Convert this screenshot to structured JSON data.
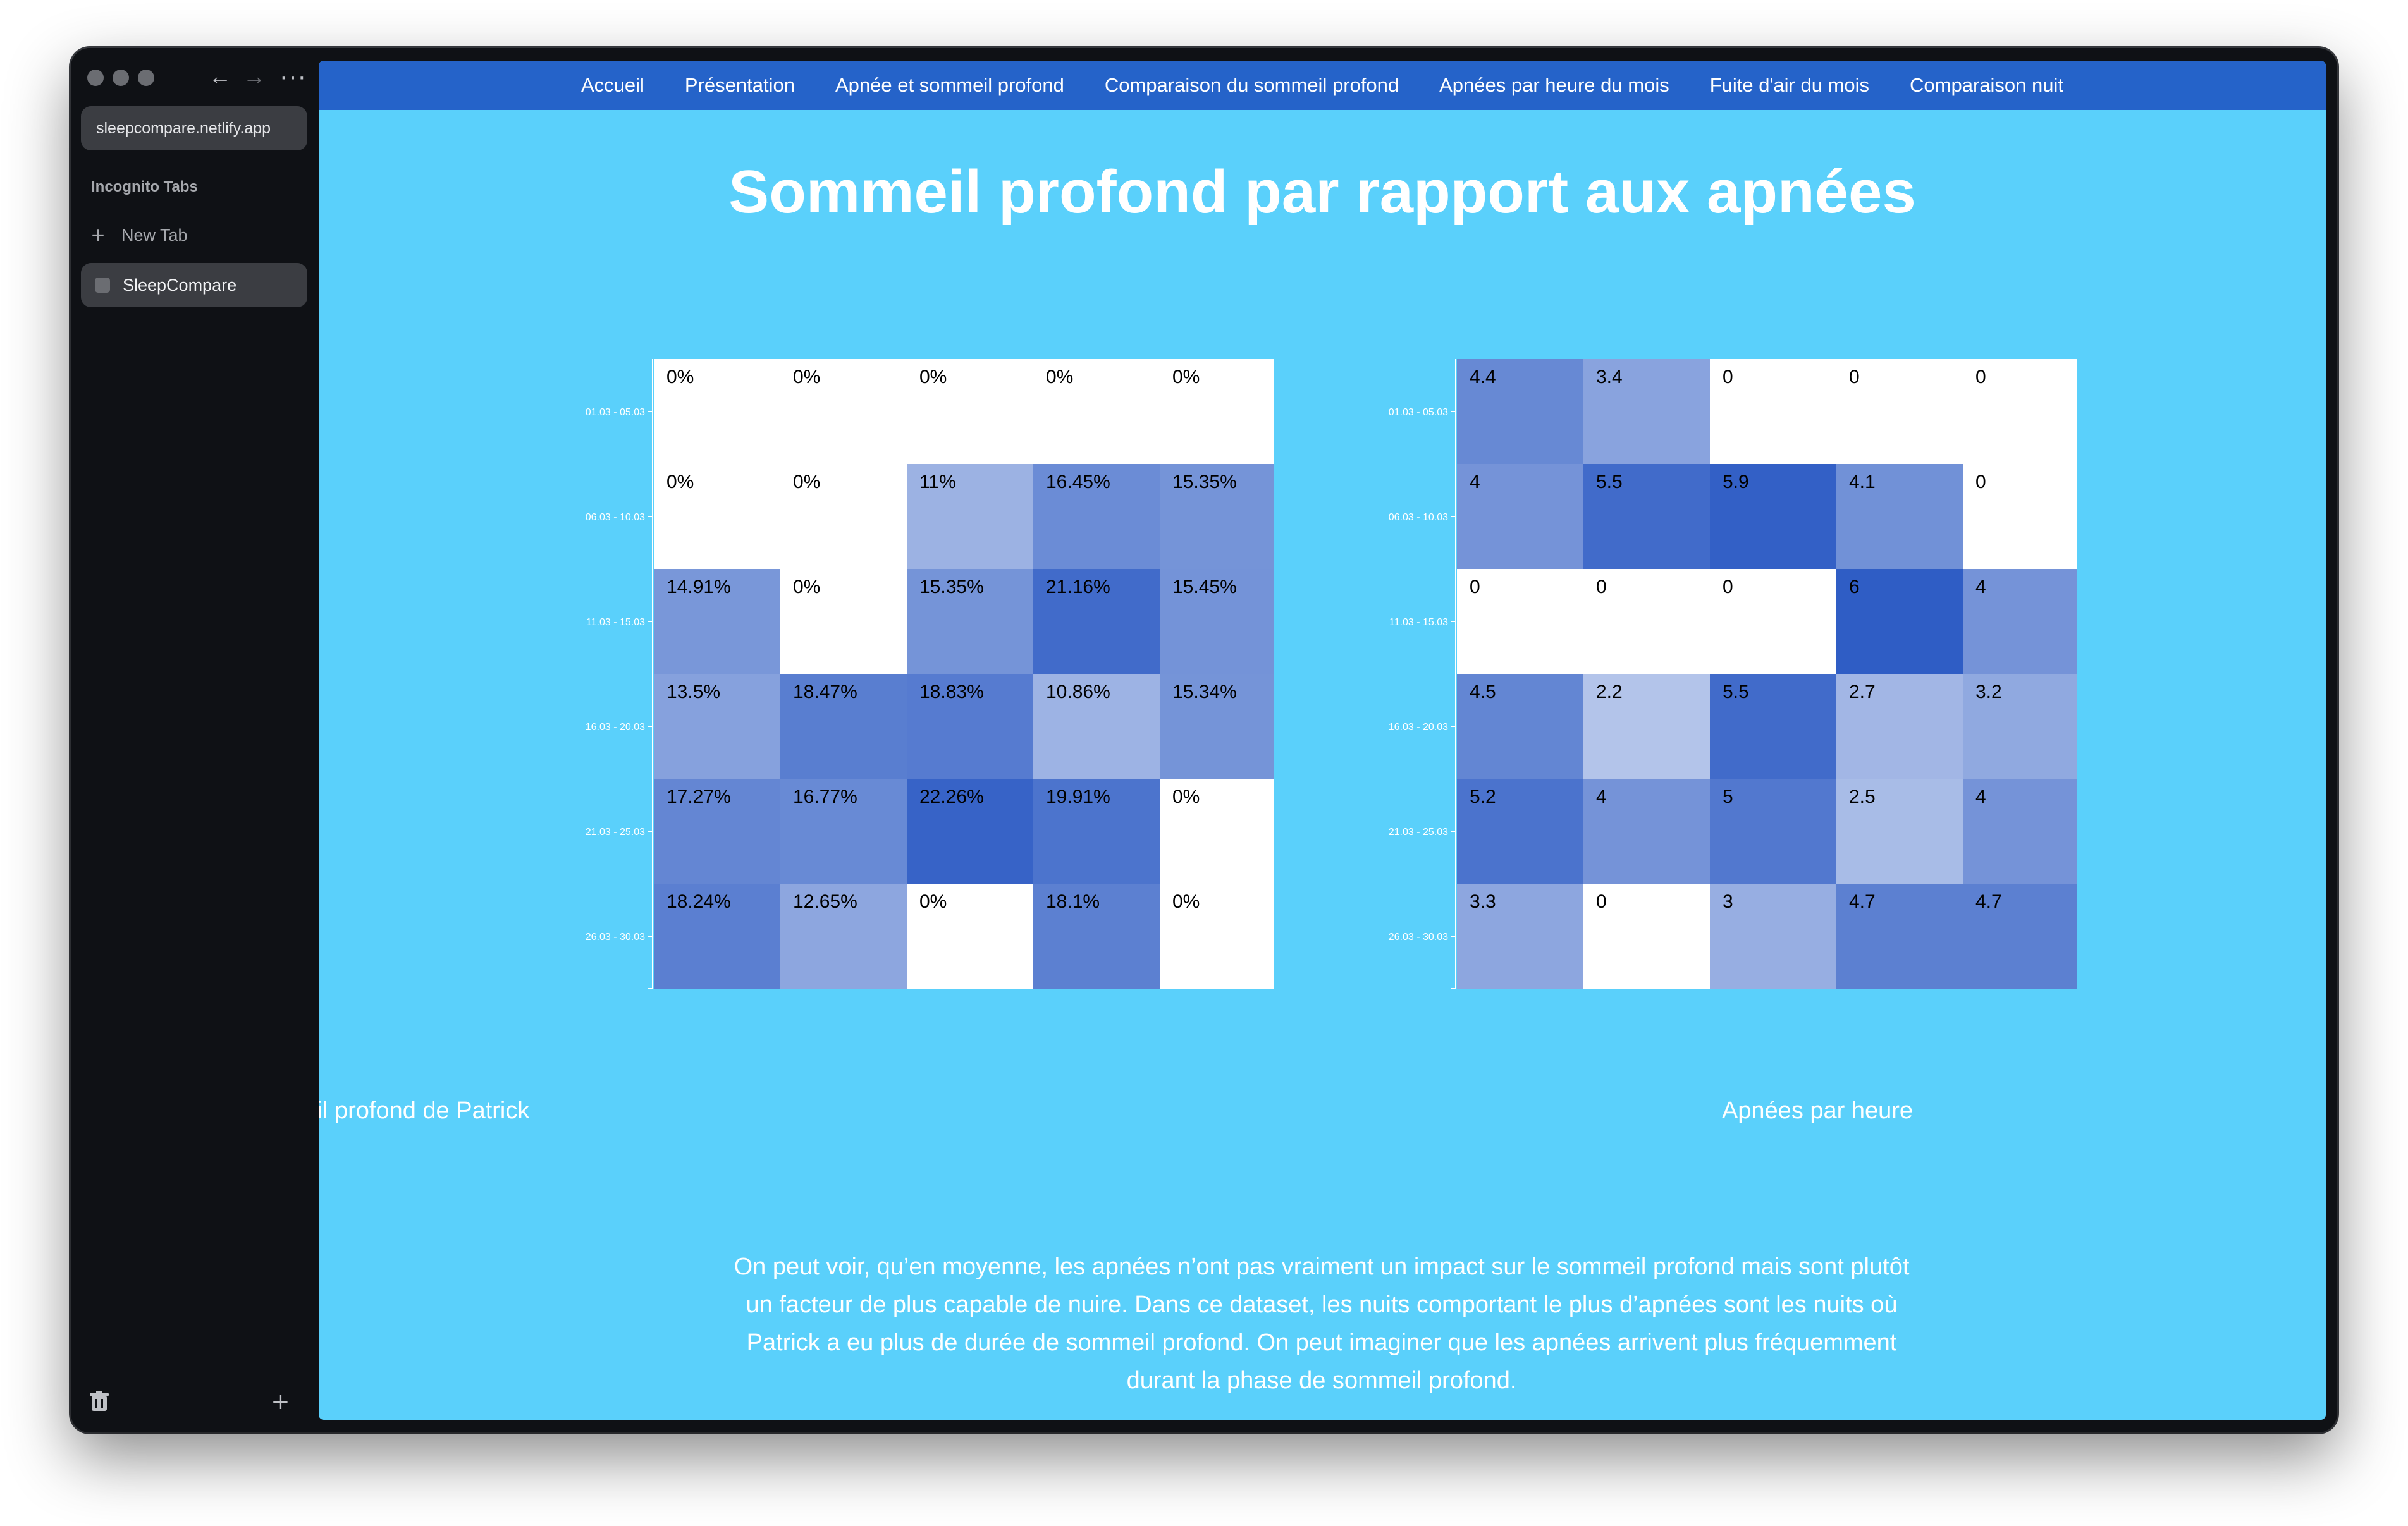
{
  "browser": {
    "url": "sleepcompare.netlify.app",
    "section_label": "Incognito Tabs",
    "new_tab_label": "New Tab",
    "active_tab_label": "SleepCompare"
  },
  "nav": {
    "items": [
      "Accueil",
      "Présentation",
      "Apnée et sommeil profond",
      "Comparaison du sommeil profond",
      "Apnées par heure du mois",
      "Fuite d'air du mois",
      "Comparaison nuit"
    ]
  },
  "page": {
    "title": "Sommeil profond par rapport aux apnées",
    "caption_left": "Sommeil profond de Patrick",
    "caption_right": "Apnées par heure",
    "paragraph": "On peut voir, qu’en moyenne, les apnées n’ont pas vraiment un impact sur le sommeil profond mais sont plutôt un facteur de plus capable de nuire. Dans ce dataset, les nuits comportant le plus d’apnées sont les nuits où Patrick a eu plus de durée de sommeil profond. On peut imaginer que les apnées arrivent plus fréquemment durant la phase de sommeil profond."
  },
  "colors": {
    "nav_bg": "#2563c9",
    "content_bg": "#5ad0fb",
    "heat_low": "#ffffff",
    "heat_high": "#1e50c0"
  },
  "chart_data": [
    {
      "type": "heatmap",
      "rows": [
        "01.03 - 05.03",
        "06.03 - 10.03",
        "11.03 - 15.03",
        "16.03 - 20.03",
        "21.03 - 25.03",
        "26.03 - 30.03"
      ],
      "values": [
        [
          0,
          0,
          0,
          0,
          0
        ],
        [
          0,
          0,
          11,
          16.45,
          15.35
        ],
        [
          14.91,
          0,
          15.35,
          21.16,
          15.45
        ],
        [
          13.5,
          18.47,
          18.83,
          10.86,
          15.34
        ],
        [
          17.27,
          16.77,
          22.26,
          19.91,
          0
        ],
        [
          18.24,
          12.65,
          0,
          18.1,
          0
        ]
      ],
      "labels": [
        [
          "0%",
          "0%",
          "0%",
          "0%",
          "0%"
        ],
        [
          "0%",
          "0%",
          "11%",
          "16.45%",
          "15.35%"
        ],
        [
          "14.91%",
          "0%",
          "15.35%",
          "21.16%",
          "15.45%"
        ],
        [
          "13.5%",
          "18.47%",
          "18.83%",
          "10.86%",
          "15.34%"
        ],
        [
          "17.27%",
          "16.77%",
          "22.26%",
          "19.91%",
          "0%"
        ],
        [
          "18.24%",
          "12.65%",
          "0%",
          "18.1%",
          "0%"
        ]
      ],
      "max": 25
    },
    {
      "type": "heatmap",
      "rows": [
        "01.03 - 05.03",
        "06.03 - 10.03",
        "11.03 - 15.03",
        "16.03 - 20.03",
        "21.03 - 25.03",
        "26.03 - 30.03"
      ],
      "values": [
        [
          4.4,
          3.4,
          0,
          0,
          0
        ],
        [
          4,
          5.5,
          5.9,
          4.1,
          0
        ],
        [
          0,
          0,
          0,
          6,
          4
        ],
        [
          4.5,
          2.2,
          5.5,
          2.7,
          3.2
        ],
        [
          5.2,
          4,
          5,
          2.5,
          4
        ],
        [
          3.3,
          0,
          3,
          4.7,
          4.7
        ]
      ],
      "labels": [
        [
          "4.4",
          "3.4",
          "0",
          "0",
          "0"
        ],
        [
          "4",
          "5.5",
          "5.9",
          "4.1",
          "0"
        ],
        [
          "0",
          "0",
          "0",
          "6",
          "4"
        ],
        [
          "4.5",
          "2.2",
          "5.5",
          "2.7",
          "3.2"
        ],
        [
          "5.2",
          "4",
          "5",
          "2.5",
          "4"
        ],
        [
          "3.3",
          "0",
          "3",
          "4.7",
          "4.7"
        ]
      ],
      "max": 6.5
    }
  ]
}
